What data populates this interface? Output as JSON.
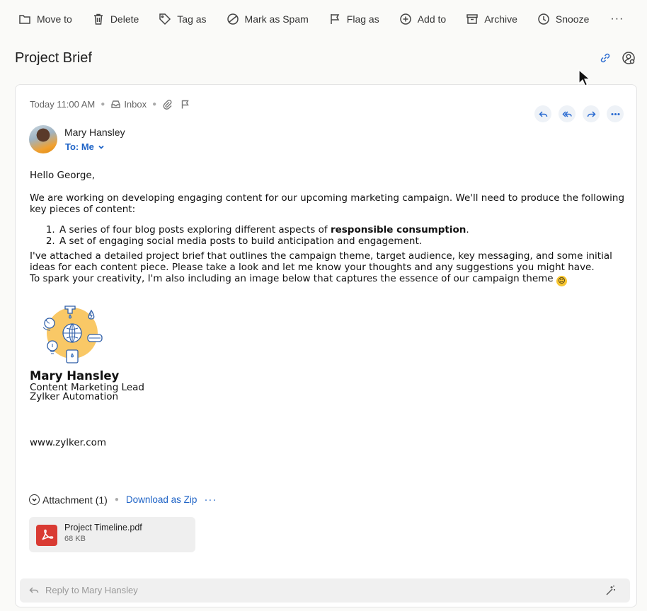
{
  "toolbar": {
    "move_to": "Move to",
    "delete": "Delete",
    "tag_as": "Tag as",
    "mark_spam": "Mark as Spam",
    "flag_as": "Flag as",
    "add_to": "Add to",
    "archive": "Archive",
    "snooze": "Snooze",
    "more": "···"
  },
  "header": {
    "title": "Project Brief"
  },
  "email": {
    "time": "Today 11:00 AM",
    "folder": "Inbox",
    "sender": "Mary Hansley",
    "to": "To: Me",
    "greeting": "Hello George,",
    "para1": "We are working on developing engaging content for our upcoming marketing campaign. We'll need to produce the following key pieces of content:",
    "list": [
      {
        "pre": "A series of four blog posts exploring different aspects of ",
        "bold": "responsible consumption",
        "post": "."
      },
      {
        "text": "A set of engaging social media posts to build anticipation and engagement."
      }
    ],
    "para2": "I've attached a detailed project brief that outlines the campaign theme, target audience, key messaging, and some initial ideas for each content piece. Please take a look and let me know your thoughts and any suggestions you might have.",
    "para3": "To spark your creativity, I'm also including an image below that captures the essence of our campaign theme",
    "emoji": "😊"
  },
  "signature": {
    "name": "Mary Hansley",
    "role": "Content Marketing Lead",
    "company": "Zylker Automation",
    "website": "www.zylker.com"
  },
  "attachments": {
    "label": "Attachment (1)",
    "download_zip": "Download as Zip",
    "more": "···",
    "files": [
      {
        "name": "Project Timeline.pdf",
        "size": "68 KB"
      }
    ]
  },
  "reply": {
    "placeholder": "Reply to Mary Hansley"
  },
  "colors": {
    "accent": "#1e63c6",
    "pdf": "#d93b33",
    "illustration": "#f9c866"
  }
}
